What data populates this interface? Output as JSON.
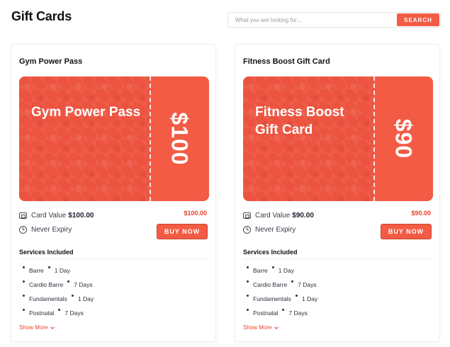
{
  "page": {
    "title": "Gift Cards"
  },
  "search": {
    "placeholder": "What you are looking for...",
    "button_label": "SEARCH"
  },
  "colors": {
    "accent": "#f35b45",
    "price": "#e8432d"
  },
  "cards": [
    {
      "title": "Gym Power Pass",
      "gift_name": "Gym Power Pass",
      "gift_amount": "$100",
      "card_value_label": "Card Value",
      "card_value": "$100.00",
      "price": "$100.00",
      "expiry": "Never Expiry",
      "buy_label": "BUY NOW",
      "services_title": "Services Included",
      "services": [
        {
          "name": "Barre",
          "duration": "1 Day"
        },
        {
          "name": "Cardio Barre",
          "duration": "7 Days"
        },
        {
          "name": "Fundamentals",
          "duration": "1 Day"
        },
        {
          "name": "Postnatal",
          "duration": "7 Days"
        }
      ],
      "show_more": "Show More"
    },
    {
      "title": "Fitness Boost Gift Card",
      "gift_name": "Fitness Boost Gift Card",
      "gift_amount": "$90",
      "card_value_label": "Card Value",
      "card_value": "$90.00",
      "price": "$90.00",
      "expiry": "Never Expiry",
      "buy_label": "BUY NOW",
      "services_title": "Services Included",
      "services": [
        {
          "name": "Barre",
          "duration": "1 Day"
        },
        {
          "name": "Cardio Barre",
          "duration": "7 Days"
        },
        {
          "name": "Fundamentals",
          "duration": "1 Day"
        },
        {
          "name": "Postnatal",
          "duration": "7 Days"
        }
      ],
      "show_more": "Show More"
    }
  ]
}
